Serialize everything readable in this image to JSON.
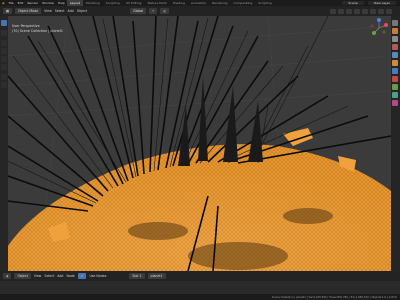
{
  "topbar": {
    "menus": [
      "File",
      "Edit",
      "Render",
      "Window",
      "Help"
    ],
    "workspaces": [
      "Layout",
      "Modeling",
      "Sculpting",
      "UV Editing",
      "Texture Paint",
      "Shading",
      "Animation",
      "Rendering",
      "Compositing",
      "Scripting"
    ],
    "active_workspace": "Layout",
    "scene": "Scene",
    "view_layer": "View Layer"
  },
  "viewport_header": {
    "mode": "Object Mode",
    "menus": [
      "View",
      "Select",
      "Add",
      "Object"
    ],
    "orientation": "Global"
  },
  "viewport": {
    "title": "User Perspective",
    "subtitle": "(70) Scene Collection | planet1"
  },
  "bottom_header": {
    "items": [
      "Object",
      "View",
      "Select",
      "Add",
      "Node"
    ],
    "use_nodes": "Use Nodes",
    "slot": "Slot 1",
    "material": "planet1"
  },
  "statusbar": {
    "stats": "Scene Collection | planet1 | Verts:428,990 | Faces:832,760 | Tris:1,665,520 | Objects:1/1 | 2.83.0"
  },
  "colors": {
    "accent": "#4772b3",
    "selection_orange": "#f4a13a",
    "viewport_bg": "#3d3d3d"
  }
}
